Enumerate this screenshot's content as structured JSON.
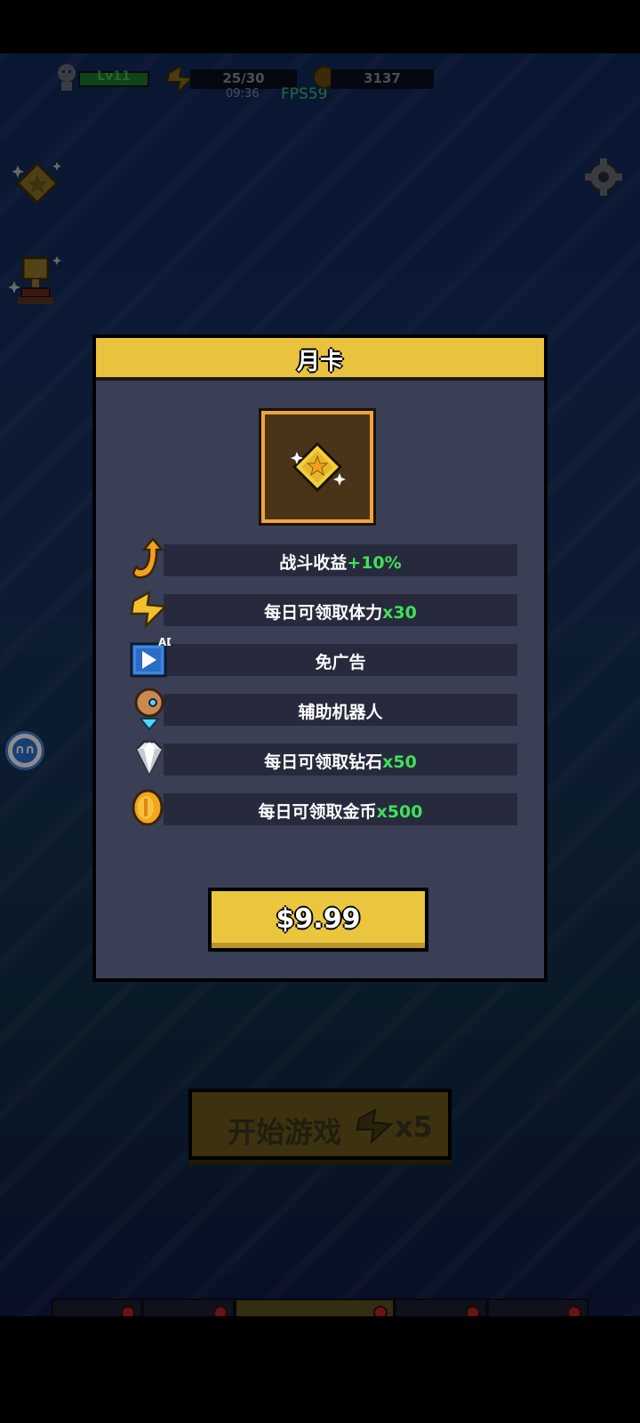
{
  "hud": {
    "level": "Lv11",
    "energy": "25/30",
    "timer": "09:36",
    "fps": "FPS59",
    "coins": "3137"
  },
  "start_button": {
    "label": "开始游戏",
    "cost": "x5"
  },
  "modal": {
    "title": "月卡",
    "benefits": [
      {
        "text": "战斗收益",
        "highlight": "+10%",
        "icon": "arrow-up-icon"
      },
      {
        "text": "每日可领取体力",
        "highlight": "x30",
        "icon": "energy-bolt-icon"
      },
      {
        "text": "免广告",
        "highlight": "",
        "icon": "ad-play-icon",
        "icon_label": "AD"
      },
      {
        "text": "辅助机器人",
        "highlight": "",
        "icon": "robot-icon"
      },
      {
        "text": "每日可领取钻石",
        "highlight": "x50",
        "icon": "diamond-icon"
      },
      {
        "text": "每日可领取金币",
        "highlight": "x500",
        "icon": "gold-coin-icon"
      }
    ],
    "price": "$9.99"
  },
  "colors": {
    "accent_yellow": "#e9c23e",
    "highlight_green": "#3fe05a",
    "panel_bg": "#3a3f55"
  }
}
